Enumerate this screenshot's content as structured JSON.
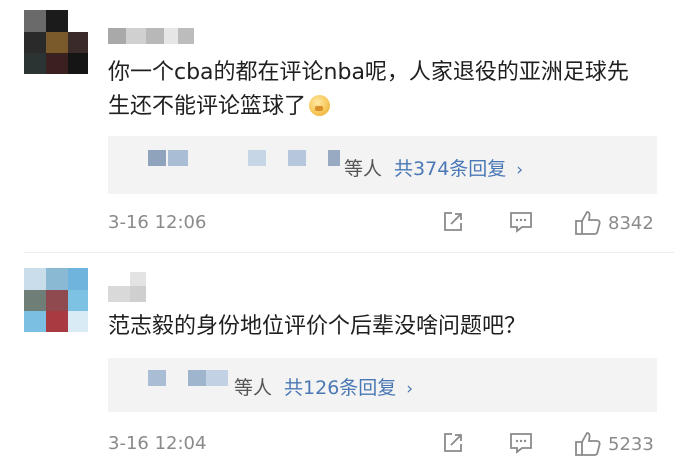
{
  "comments": [
    {
      "text": "你一个cba的都在评论nba呢，人家退役的亚洲足球先生还不能评论篮球了",
      "reply_suffix": "等人",
      "reply_total": "共374条回复",
      "reply_arrow": "›",
      "time": "3-16 12:06",
      "likes": "8342"
    },
    {
      "text": "范志毅的身份地位评价个后辈没啥问题吧？",
      "reply_suffix": "等人",
      "reply_total": "共126条回复",
      "reply_arrow": "›",
      "time": "3-16 12:04",
      "likes": "5233"
    }
  ],
  "icons": {
    "share": "share-icon",
    "reply": "comment-icon",
    "like": "thumbs-up-icon"
  },
  "colors": {
    "link": "#4a78b5",
    "meta": "#8a8a8a",
    "reply_bg": "#f3f3f3"
  }
}
